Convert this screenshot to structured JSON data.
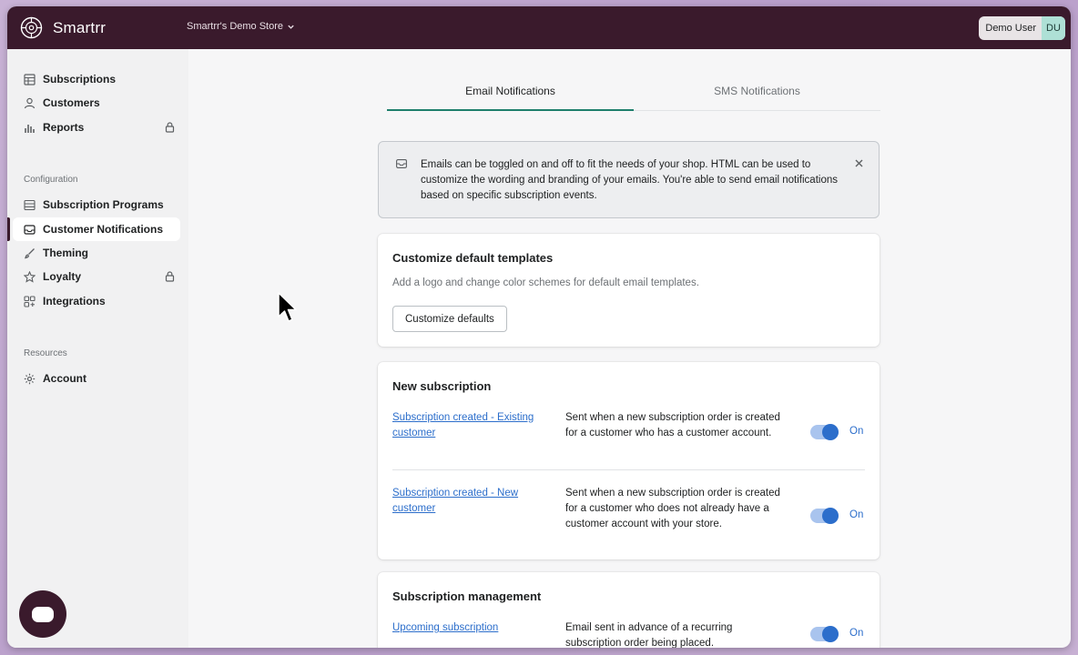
{
  "app": {
    "name": "Smartrr",
    "store": "Smartrr's Demo Store"
  },
  "user": {
    "name": "Demo User",
    "initials": "DU"
  },
  "sidebar": {
    "items": [
      {
        "label": "Subscriptions",
        "icon": "table-icon"
      },
      {
        "label": "Customers",
        "icon": "person-icon"
      },
      {
        "label": "Reports",
        "icon": "bar-chart-icon",
        "locked": true
      }
    ],
    "configuration_label": "Configuration",
    "config_items": [
      {
        "label": "Subscription Programs",
        "icon": "list-icon"
      },
      {
        "label": "Customer Notifications",
        "icon": "inbox-icon",
        "active": true
      },
      {
        "label": "Theming",
        "icon": "paintbrush-icon"
      },
      {
        "label": "Loyalty",
        "icon": "star-icon",
        "locked": true
      },
      {
        "label": "Integrations",
        "icon": "apps-icon"
      }
    ],
    "resources_label": "Resources",
    "resource_items": [
      {
        "label": "Account",
        "icon": "gear-icon"
      }
    ]
  },
  "tabs": [
    {
      "label": "Email Notifications",
      "active": true
    },
    {
      "label": "SMS Notifications",
      "active": false
    }
  ],
  "banner": {
    "text": "Emails can be toggled on and off to fit the needs of your shop. HTML can be used to customize the wording and branding of your emails. You're able to send email notifications based on specific subscription events."
  },
  "templates_card": {
    "title": "Customize default templates",
    "subtitle": "Add a logo and change color schemes for default email templates.",
    "button": "Customize defaults"
  },
  "new_subscription": {
    "title": "New subscription",
    "rows": [
      {
        "link": "Subscription created - Existing customer",
        "desc": "Sent when a new subscription order is created for a customer who has a customer account.",
        "status": "On"
      },
      {
        "link": "Subscription created - New customer",
        "desc": "Sent when a new subscription order is created for a customer who does not already have a customer account with your store.",
        "status": "On"
      }
    ]
  },
  "subscription_management": {
    "title": "Subscription management",
    "rows": [
      {
        "link": "Upcoming subscription",
        "desc": "Email sent in advance of a recurring subscription order being placed.",
        "status": "On"
      }
    ]
  },
  "colors": {
    "topbar": "#3a1a2c",
    "accent": "#1e7f6c",
    "link": "#2c6ecb"
  }
}
